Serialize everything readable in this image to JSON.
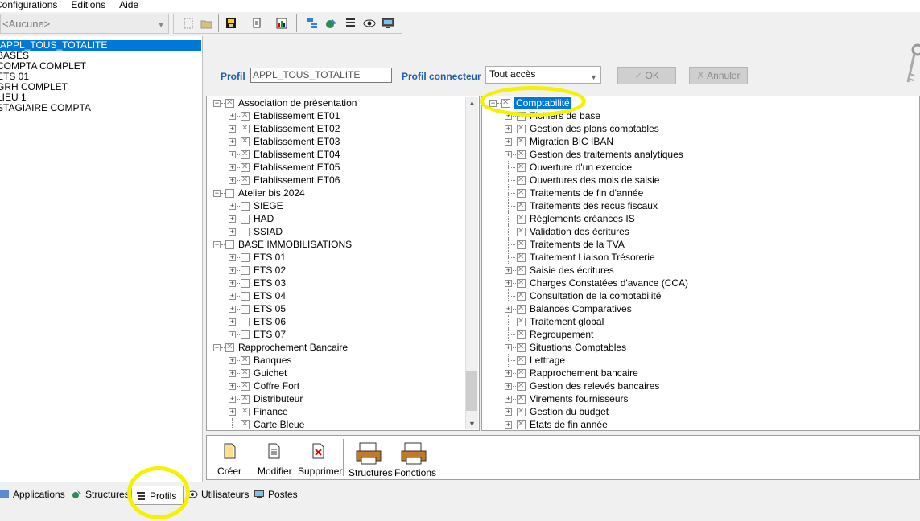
{
  "menu": {
    "items": [
      "Configurations",
      "Editions",
      "Aide"
    ]
  },
  "toolbar": {
    "combo_value": "<Aucune>",
    "buttons": [
      "new-icon",
      "open-icon",
      "save-icon",
      "document-icon",
      "chart-icon",
      "tree-structure-icon",
      "map-icon",
      "list-icon",
      "view-icon",
      "monitor-icon"
    ]
  },
  "left_list": {
    "items": [
      "APPL_TOUS_TOTALITE",
      "BASES",
      "COMPTA COMPLET",
      "ETS 01",
      "GRH COMPLET",
      "LIEU 1",
      "STAGIAIRE COMPTA"
    ],
    "selected": 0
  },
  "header": {
    "profil_label": "Profil",
    "profil_value": "APPL_TOUS_TOTALITE",
    "connecteur_label": "Profil connecteur",
    "connecteur_value": "Tout accès",
    "ok_label": "OK",
    "annuler_label": "Annuler"
  },
  "left_tree": [
    {
      "label": "Association de présentation",
      "level": 0,
      "expanded": true,
      "checked": true
    },
    {
      "label": "Etablissement ET01",
      "level": 1,
      "expanded": false,
      "checked": true
    },
    {
      "label": "Etablissement ET02",
      "level": 1,
      "expanded": false,
      "checked": true
    },
    {
      "label": "Etablissement ET03",
      "level": 1,
      "expanded": false,
      "checked": true
    },
    {
      "label": "Etablissement ET04",
      "level": 1,
      "expanded": false,
      "checked": true
    },
    {
      "label": "Etablissement ET05",
      "level": 1,
      "expanded": false,
      "checked": true
    },
    {
      "label": "Etablissement ET06",
      "level": 1,
      "expanded": false,
      "checked": true
    },
    {
      "label": "Atelier bis 2024",
      "level": 0,
      "expanded": true,
      "checked": false
    },
    {
      "label": "SIEGE",
      "level": 1,
      "expanded": false,
      "checked": false
    },
    {
      "label": "HAD",
      "level": 1,
      "expanded": false,
      "checked": false
    },
    {
      "label": "SSIAD",
      "level": 1,
      "expanded": false,
      "checked": false
    },
    {
      "label": "BASE IMMOBILISATIONS",
      "level": 0,
      "expanded": true,
      "checked": false
    },
    {
      "label": "ETS 01",
      "level": 1,
      "expanded": false,
      "checked": false
    },
    {
      "label": "ETS 02",
      "level": 1,
      "expanded": false,
      "checked": false
    },
    {
      "label": "ETS 03",
      "level": 1,
      "expanded": false,
      "checked": false
    },
    {
      "label": "ETS 04",
      "level": 1,
      "expanded": false,
      "checked": false
    },
    {
      "label": "ETS 05",
      "level": 1,
      "expanded": false,
      "checked": false
    },
    {
      "label": "ETS 06",
      "level": 1,
      "expanded": false,
      "checked": false
    },
    {
      "label": "ETS 07",
      "level": 1,
      "expanded": false,
      "checked": false
    },
    {
      "label": "Rapprochement Bancaire",
      "level": 0,
      "expanded": true,
      "checked": true
    },
    {
      "label": "Banques",
      "level": 1,
      "expanded": false,
      "checked": true
    },
    {
      "label": "Guichet",
      "level": 1,
      "expanded": false,
      "checked": true
    },
    {
      "label": "Coffre Fort",
      "level": 1,
      "expanded": false,
      "checked": true
    },
    {
      "label": "Distributeur",
      "level": 1,
      "expanded": false,
      "checked": true
    },
    {
      "label": "Finance",
      "level": 1,
      "expanded": false,
      "checked": true
    },
    {
      "label": "Carte Bleue",
      "level": 1,
      "leaf": true,
      "checked": true
    }
  ],
  "right_tree": [
    {
      "label": "Comptabilité",
      "level": 0,
      "expanded": true,
      "checked": true,
      "selected": true
    },
    {
      "label": "Fichiers de base",
      "level": 1,
      "expanded": false,
      "checked": true
    },
    {
      "label": "Gestion des plans comptables",
      "level": 1,
      "expanded": false,
      "checked": true
    },
    {
      "label": "Migration BIC IBAN",
      "level": 1,
      "expanded": false,
      "checked": true
    },
    {
      "label": "Gestion des traitements analytiques",
      "level": 1,
      "expanded": false,
      "checked": true
    },
    {
      "label": "Ouverture d'un exercice",
      "level": 1,
      "leaf": true,
      "checked": true
    },
    {
      "label": "Ouvertures des mois de saisie",
      "level": 1,
      "leaf": true,
      "checked": true
    },
    {
      "label": "Traitements de fin d'année",
      "level": 1,
      "leaf": true,
      "checked": true
    },
    {
      "label": "Traitements des recus fiscaux",
      "level": 1,
      "leaf": true,
      "checked": true
    },
    {
      "label": "Règlements créances IS",
      "level": 1,
      "leaf": true,
      "checked": true
    },
    {
      "label": "Validation des écritures",
      "level": 1,
      "leaf": true,
      "checked": true
    },
    {
      "label": "Traitements de la TVA",
      "level": 1,
      "leaf": true,
      "checked": true
    },
    {
      "label": "Traitement Liaison Trésorerie",
      "level": 1,
      "leaf": true,
      "checked": true
    },
    {
      "label": "Saisie des écritures",
      "level": 1,
      "expanded": false,
      "checked": true
    },
    {
      "label": "Charges Constatées d'avance (CCA)",
      "level": 1,
      "expanded": false,
      "checked": true
    },
    {
      "label": "Consultation de la comptabilité",
      "level": 1,
      "leaf": true,
      "checked": true
    },
    {
      "label": "Balances Comparatives",
      "level": 1,
      "expanded": false,
      "checked": true
    },
    {
      "label": "Traitement global",
      "level": 1,
      "leaf": true,
      "checked": true
    },
    {
      "label": "Regroupement",
      "level": 1,
      "leaf": true,
      "checked": true
    },
    {
      "label": "Situations Comptables",
      "level": 1,
      "expanded": false,
      "checked": true
    },
    {
      "label": "Lettrage",
      "level": 1,
      "leaf": true,
      "checked": true
    },
    {
      "label": "Rapprochement bancaire",
      "level": 1,
      "expanded": false,
      "checked": true
    },
    {
      "label": "Gestion des relevés bancaires",
      "level": 1,
      "expanded": false,
      "checked": true
    },
    {
      "label": "Virements fournisseurs",
      "level": 1,
      "expanded": false,
      "checked": true
    },
    {
      "label": "Gestion du budget",
      "level": 1,
      "expanded": false,
      "checked": true
    },
    {
      "label": "Etats de fin année",
      "level": 1,
      "expanded": false,
      "checked": true
    }
  ],
  "actions": {
    "creer": "Créer",
    "modifier": "Modifier",
    "supprimer": "Supprimer",
    "structures": "Structures",
    "fonctions": "Fonctions"
  },
  "tabs": [
    {
      "label": "Applications",
      "icon": "applications-icon"
    },
    {
      "label": "Structures",
      "icon": "structures-icon"
    },
    {
      "label": "Profils",
      "icon": "profils-icon",
      "active": true
    },
    {
      "label": "Utilisateurs",
      "icon": "users-icon"
    },
    {
      "label": "Postes",
      "icon": "monitor-icon"
    }
  ],
  "colors": {
    "accent": "#0078d7",
    "label_blue": "#1e5fb3",
    "highlight_annotation": "#f5f200"
  }
}
